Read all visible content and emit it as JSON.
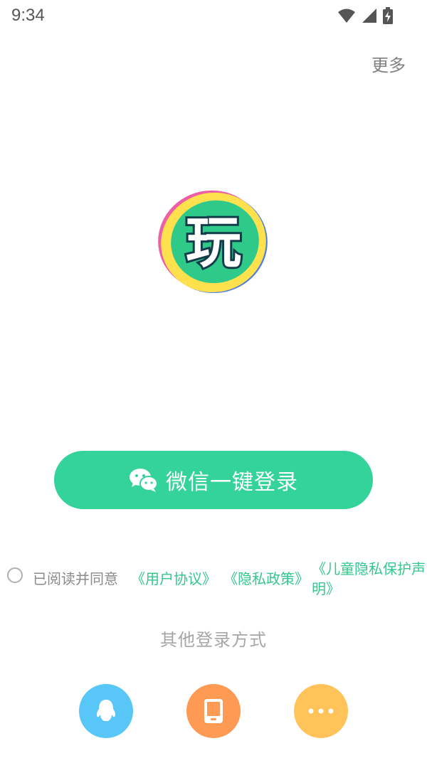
{
  "status_bar": {
    "time": "9:34"
  },
  "header": {
    "more_label": "更多"
  },
  "logo": {
    "text": "玩"
  },
  "wechat_login": {
    "label": "微信一键登录",
    "icon": "wechat-icon",
    "color": "#34D399"
  },
  "agreement": {
    "prefix": "已阅读并同意",
    "user_agreement": "《用户协议》",
    "privacy_policy": "《隐私政策》",
    "children_privacy": "《儿童隐私保护声明》"
  },
  "other_login": {
    "title": "其他登录方式",
    "methods": [
      {
        "name": "qq",
        "icon": "qq-icon",
        "color": "#58C6F7"
      },
      {
        "name": "phone",
        "icon": "phone-icon",
        "color": "#FF9A55"
      },
      {
        "name": "more",
        "icon": "ellipsis-icon",
        "color": "#FFC35A"
      }
    ]
  },
  "colors": {
    "accent_green": "#34C78C"
  }
}
